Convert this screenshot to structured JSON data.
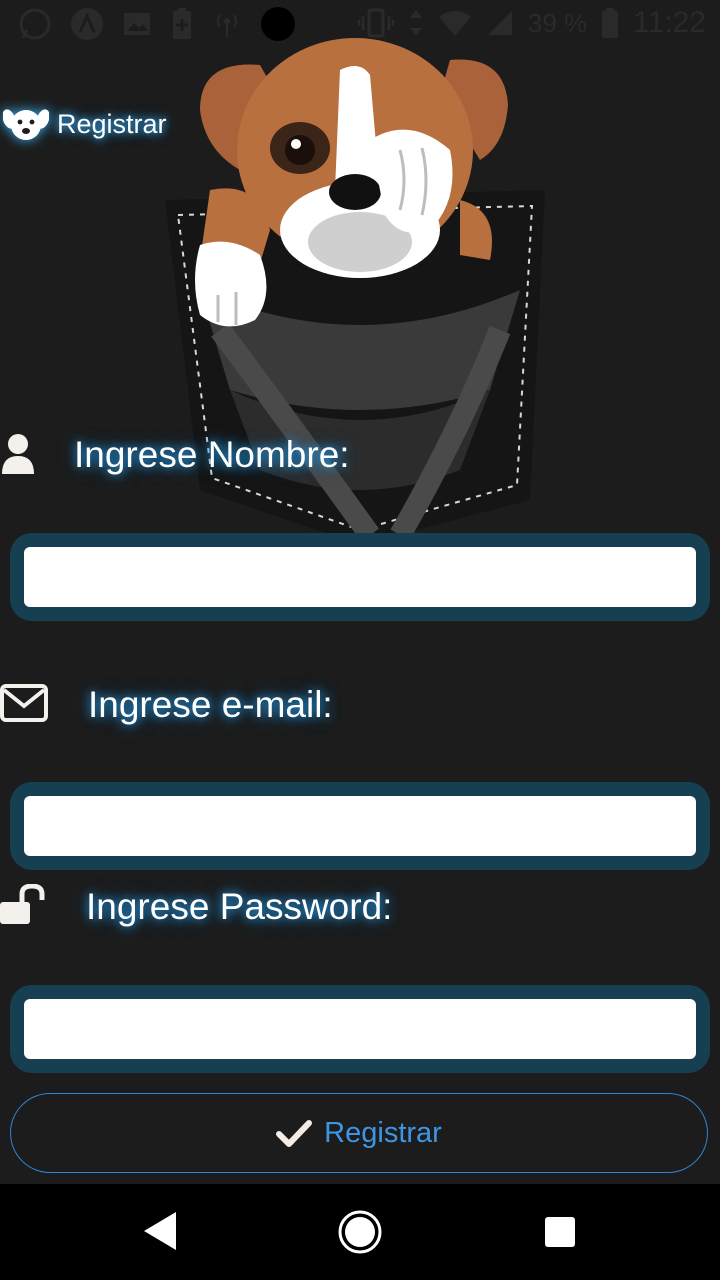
{
  "status_bar": {
    "battery_percent": "39 %",
    "time": "11:22"
  },
  "header": {
    "brand_icon": "dog-face-icon",
    "title": "Registrar"
  },
  "form": {
    "name_label": "Ingrese Nombre:",
    "name_value": "",
    "email_label": "Ingrese e-mail:",
    "email_value": "",
    "password_label": "Ingrese Password:",
    "password_value": "",
    "submit_label": "Registrar"
  },
  "icons": {
    "name": "user-icon",
    "email": "envelope-icon",
    "password": "unlock-icon",
    "submit": "check-icon"
  },
  "colors": {
    "background": "#1c1c1c",
    "input_frame": "#173f52",
    "accent": "#3d95e4",
    "glow": "#27a9ff"
  }
}
